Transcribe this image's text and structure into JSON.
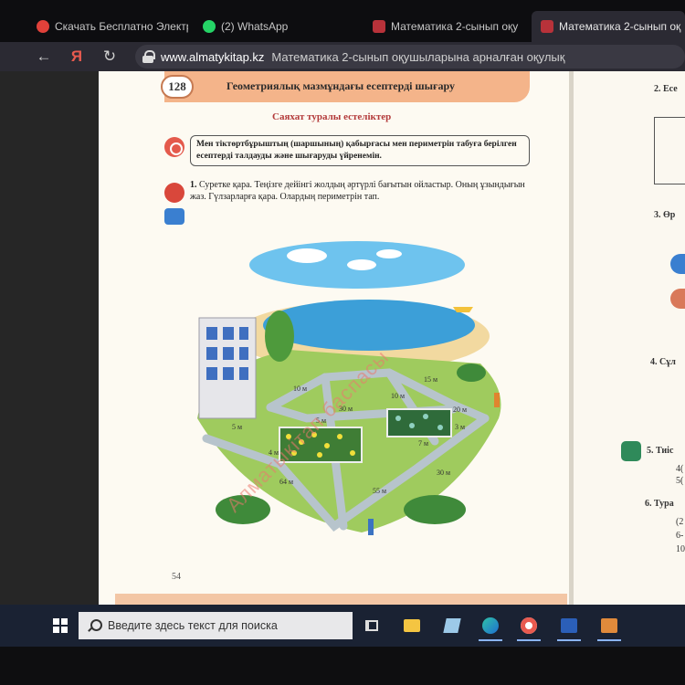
{
  "browser": {
    "tabs": [
      {
        "label": "Скачать Бесплатно Электр",
        "icon": "red-circle-icon",
        "color": "#e0413a",
        "active": false
      },
      {
        "label": "(2) WhatsApp",
        "icon": "whatsapp-icon",
        "color": "#25d366",
        "active": false
      },
      {
        "label": "Математика 2-сынып оқу",
        "icon": "book-icon",
        "color": "#b8323a",
        "active": false
      },
      {
        "label": "Математика 2-сынып оқ",
        "icon": "book-icon",
        "color": "#b8323a",
        "active": true
      }
    ],
    "tab_close": "✕",
    "nav": {
      "back": "←",
      "yandex": "Я",
      "reload": "↻"
    },
    "url_host": "www.almatykitap.kz",
    "url_title": "Математика 2-сынып оқушыларына арналған оқулық"
  },
  "page": {
    "lesson_number": "128",
    "lesson_title": "Геометриялық мазмұндағы есептерді шығару",
    "subtitle": "Саяхат туралы естеліктер",
    "goal_text": "Мен тіктөртбұрыштың (шаршының) қабырғасы мен периметрін табуға берілген есептерді талдауды және шығаруды үйренемін.",
    "task1_number": "1.",
    "task1_text": "Суретке қара. Теңізге дейінгі жолдың әртүрлі бағытын ойластыр. Оның ұзындығын жаз. Гүлзарларға қара. Олардың периметрін тап.",
    "illustration_labels": [
      "10 м",
      "15 м",
      "10 м",
      "30 м",
      "20 м",
      "5 м",
      "5 м",
      "3 м",
      "4 м",
      "7 м",
      "64 м",
      "30 м",
      "55 м"
    ],
    "page_number": "54",
    "watermark": "Алматыкітап баспасы"
  },
  "right_page": {
    "item2": "2. Есе",
    "item3": "3. Өр",
    "item4": "4. Сұл",
    "item5": "5. Тиіс",
    "item5_lines": [
      "4(",
      "5("
    ],
    "item6": "6. Тура",
    "item6_lines": [
      "(2",
      "6-",
      "10"
    ]
  },
  "taskbar": {
    "search_placeholder": "Введите здесь текст для поиска",
    "apps": [
      "task-view-icon",
      "file-explorer-icon",
      "notes-icon",
      "edge-icon",
      "yandex-browser-icon",
      "word-icon",
      "photos-icon"
    ]
  },
  "colors": {
    "lesson_band": "#f4b48a",
    "subtitle": "#b33a3a",
    "accent_blue": "#3a7fd0",
    "taskbar": "#1a2233"
  }
}
